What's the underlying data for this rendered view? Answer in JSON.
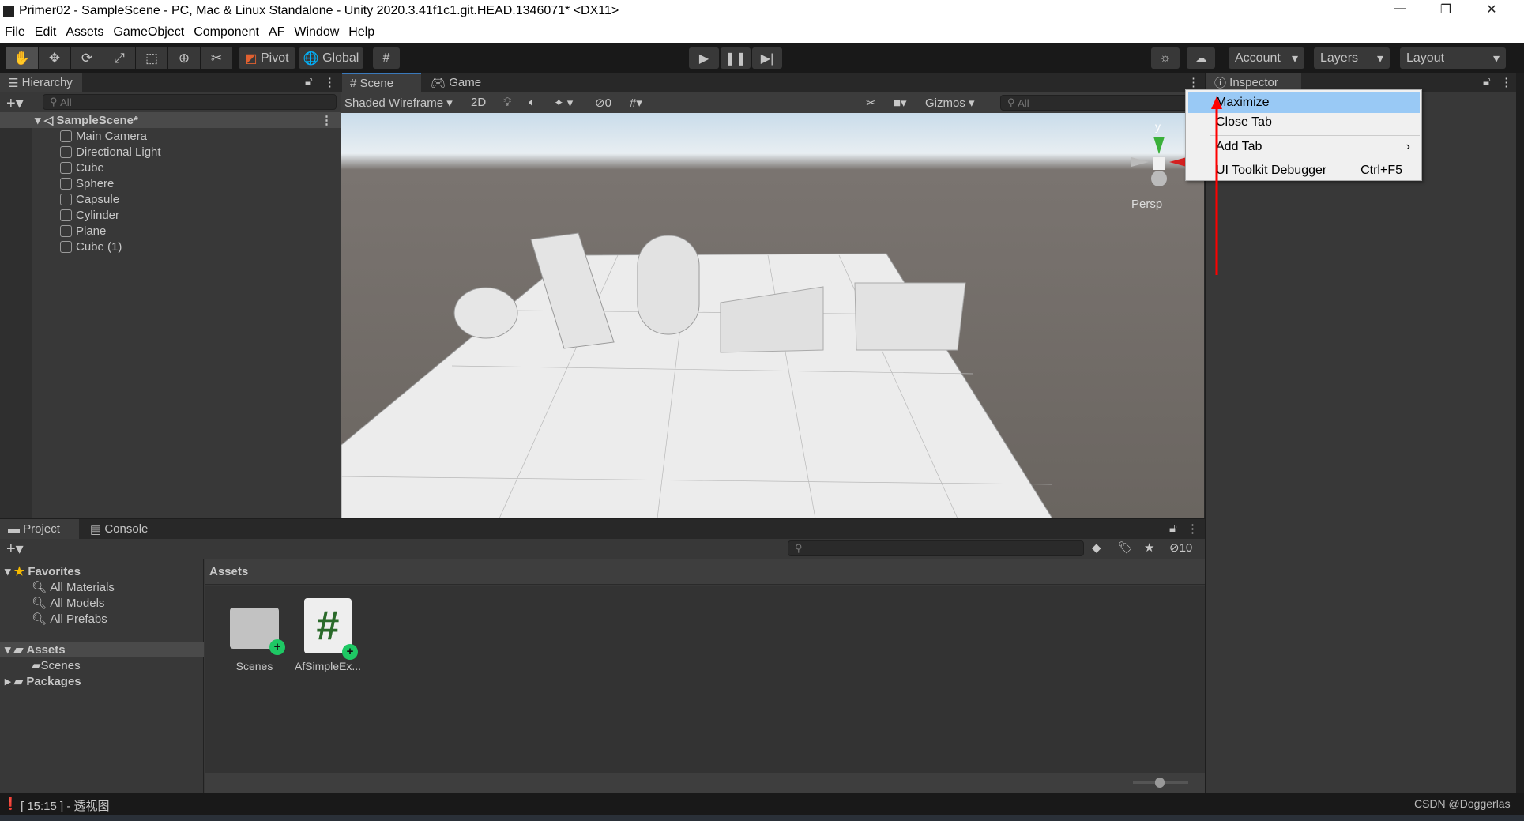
{
  "window": {
    "title": "Primer02 - SampleScene - PC, Mac & Linux Standalone - Unity 2020.3.41f1c1.git.HEAD.1346071* <DX11>",
    "minimize": "—",
    "restore": "❐",
    "close": "✕"
  },
  "menu": [
    "File",
    "Edit",
    "Assets",
    "GameObject",
    "Component",
    "AF",
    "Window",
    "Help"
  ],
  "toolbar": {
    "pivot": "Pivot",
    "global": "Global",
    "account": "Account",
    "layers": "Layers",
    "layout": "Layout"
  },
  "hierarchy": {
    "tab": "Hierarchy",
    "search_placeholder": "All",
    "scene": "SampleScene*",
    "items": [
      "Main Camera",
      "Directional Light",
      "Cube",
      "Sphere",
      "Capsule",
      "Cylinder",
      "Plane",
      "Cube (1)"
    ]
  },
  "scene": {
    "tab_scene": "Scene",
    "tab_game": "Game",
    "draw_mode": "Shaded Wireframe",
    "mode_2d": "2D",
    "hidden_count": "0",
    "gizmos": "Gizmos",
    "search_placeholder": "All",
    "projection": "Persp",
    "axis_y": "y"
  },
  "inspector": {
    "tab": "Inspector"
  },
  "context_menu": {
    "items": [
      {
        "label": "Maximize",
        "shortcut": "",
        "highlighted": true
      },
      {
        "label": "Close Tab",
        "shortcut": ""
      },
      {
        "label": "Add Tab",
        "shortcut": "›"
      },
      {
        "label": "UI Toolkit Debugger",
        "shortcut": "Ctrl+F5"
      }
    ]
  },
  "project": {
    "tab_project": "Project",
    "tab_console": "Console",
    "hidden_count": "10",
    "favorites": "Favorites",
    "favorite_items": [
      "All Materials",
      "All Models",
      "All Prefabs"
    ],
    "assets_root": "Assets",
    "asset_children": [
      "Scenes"
    ],
    "packages": "Packages",
    "breadcrumb": "Assets",
    "assets": [
      {
        "name": "Scenes",
        "type": "folder"
      },
      {
        "name": "AfSimpleEx...",
        "type": "script"
      }
    ],
    "zoom_level": 0.4
  },
  "status": {
    "message": "[ 15:15 ] - 透视图",
    "watermark": "CSDN @Doggerlas"
  },
  "colors": {
    "accent_highlight": "#99c9f5",
    "annotation_arrow": "#ff0000",
    "status_add": "#1ec864"
  }
}
